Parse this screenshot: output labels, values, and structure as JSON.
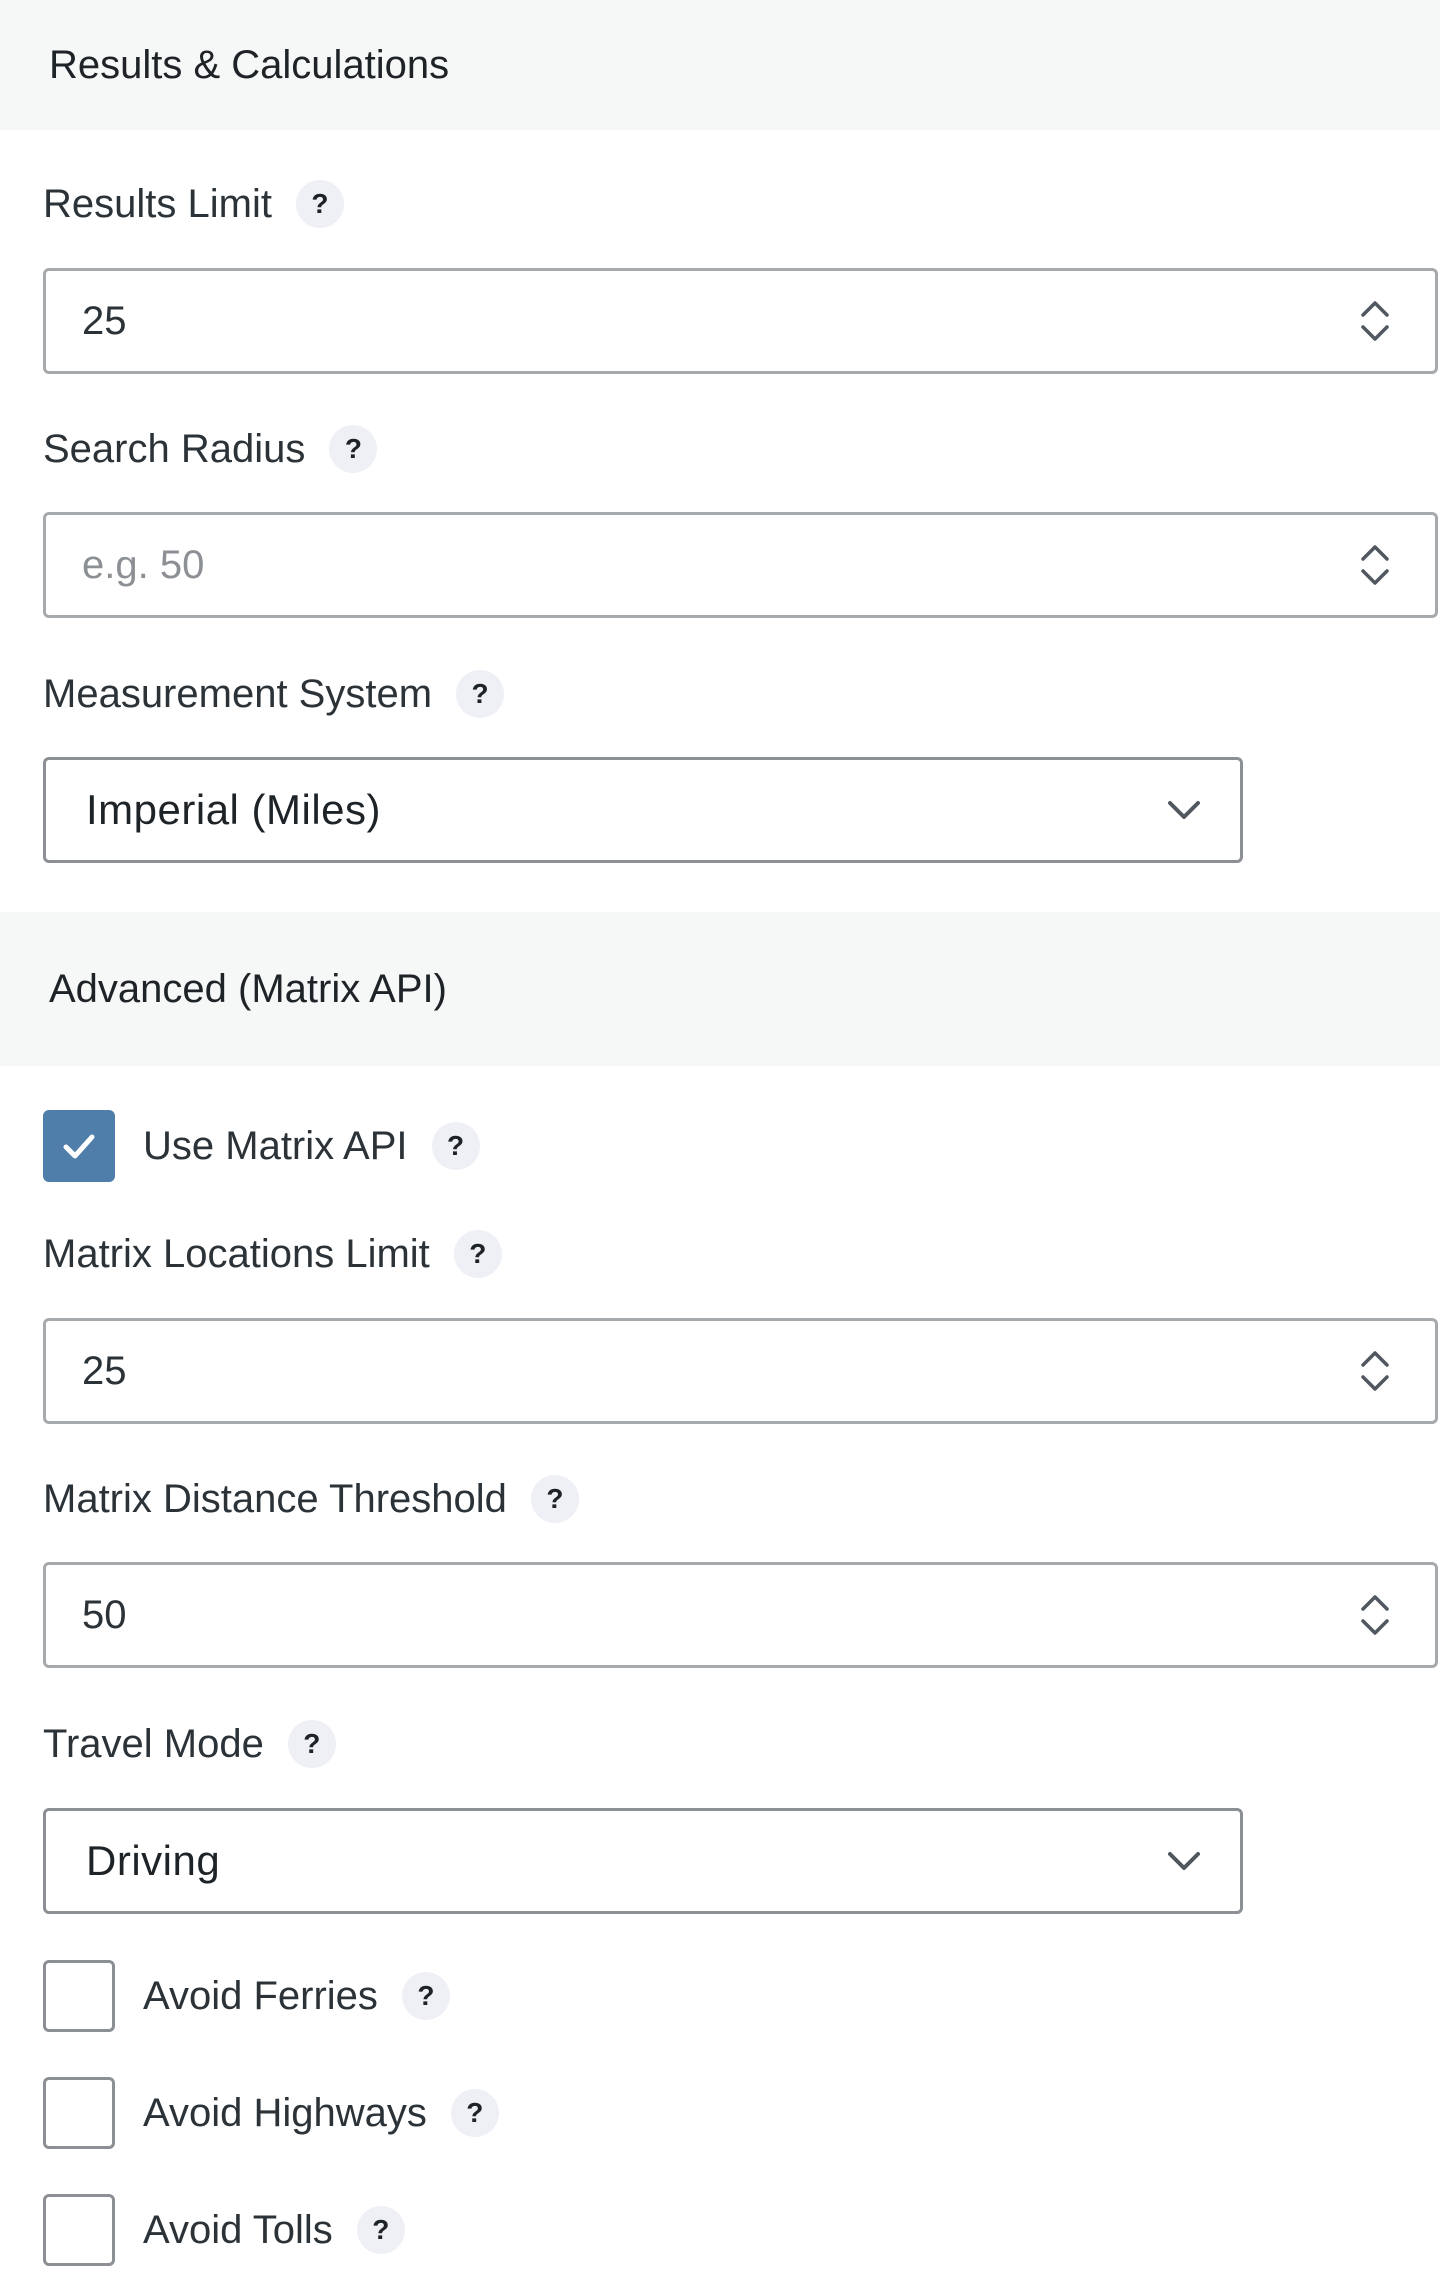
{
  "sections": {
    "results": {
      "title": "Results & Calculations"
    },
    "advanced": {
      "title": "Advanced (Matrix API)"
    }
  },
  "fields": {
    "results_limit": {
      "label": "Results Limit",
      "value": "25",
      "help": "?"
    },
    "search_radius": {
      "label": "Search Radius",
      "value": "",
      "placeholder": "e.g. 50",
      "help": "?"
    },
    "measurement_system": {
      "label": "Measurement System",
      "selected": "Imperial (Miles)",
      "help": "?"
    },
    "use_matrix_api": {
      "label": "Use Matrix API",
      "checked": true,
      "help": "?"
    },
    "matrix_locations_limit": {
      "label": "Matrix Locations Limit",
      "value": "25",
      "help": "?"
    },
    "matrix_distance_threshold": {
      "label": "Matrix Distance Threshold",
      "value": "50",
      "help": "?"
    },
    "travel_mode": {
      "label": "Travel Mode",
      "selected": "Driving",
      "help": "?"
    },
    "avoid_ferries": {
      "label": "Avoid Ferries",
      "checked": false,
      "help": "?"
    },
    "avoid_highways": {
      "label": "Avoid Highways",
      "checked": false,
      "help": "?"
    },
    "avoid_tolls": {
      "label": "Avoid Tolls",
      "checked": false,
      "help": "?"
    }
  },
  "colors": {
    "section_bg": "#f6f7f7",
    "checkbox_checked": "#4f7eaa",
    "input_border": "#a7aaad",
    "placeholder_text": "#8c8f94"
  },
  "icons": {
    "stepper": "up-down-arrows-icon",
    "select": "chevron-down-icon",
    "check": "checkmark-icon",
    "help": "question-mark-icon"
  }
}
